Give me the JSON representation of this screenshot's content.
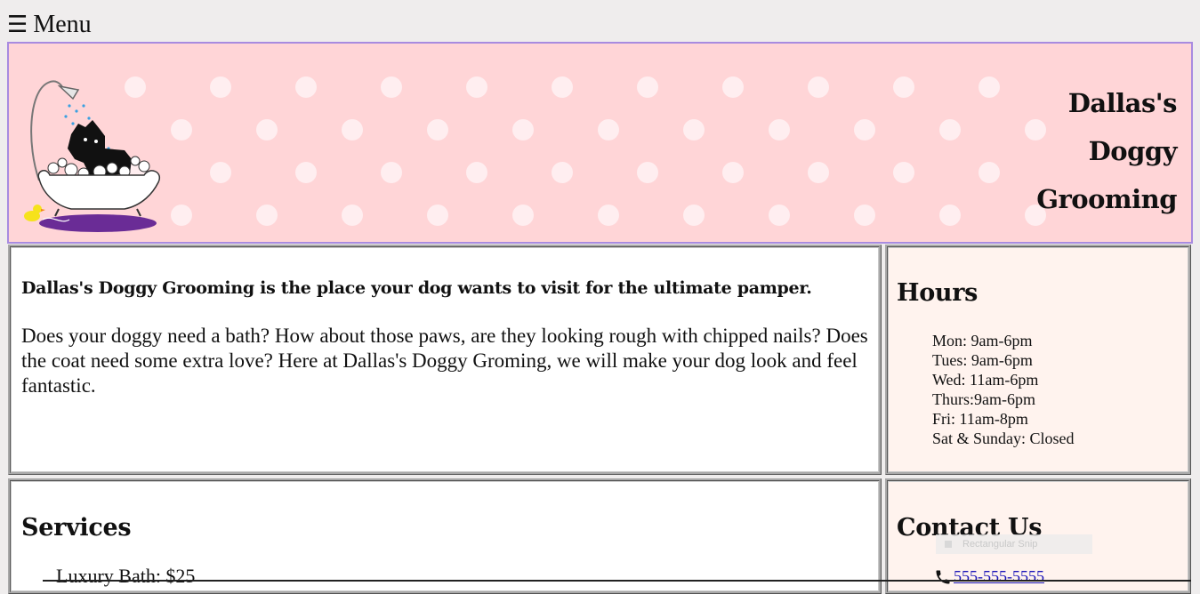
{
  "menu": {
    "icon": "hamburger-icon",
    "label": "Menu"
  },
  "banner": {
    "title_lines": [
      "Dallas's",
      "Doggy",
      "Grooming"
    ],
    "logo": "dog-in-bathtub-logo",
    "background_color": "#ffd5d7",
    "border_color": "#a88be0"
  },
  "about": {
    "lead": "Dallas's Doggy Grooming is the place your dog wants to visit for the ultimate pamper.",
    "body": "Does your doggy need a bath? How about those paws, are they looking rough with chipped nails? Does the coat need some extra love? Here at Dallas's Doggy Groming, we will make your dog look and feel fantastic."
  },
  "hours": {
    "heading": "Hours",
    "items": [
      "Mon: 9am-6pm",
      "Tues: 9am-6pm",
      "Wed: 11am-6pm",
      "Thurs:9am-6pm",
      "Fri: 11am-8pm",
      "Sat & Sunday: Closed"
    ]
  },
  "services": {
    "heading": "Services",
    "items": [
      "Luxury Bath: $25"
    ]
  },
  "contact": {
    "heading": "Contact Us",
    "phone_icon": "phone-icon",
    "phone": "555-555-5555"
  },
  "overlay": {
    "label": "Rectangular Snip"
  },
  "colors": {
    "page_bg": "#efeded",
    "panel_bg": "#ffffff",
    "side_panel_bg": "#fff3ee",
    "link": "#1a14b8"
  }
}
